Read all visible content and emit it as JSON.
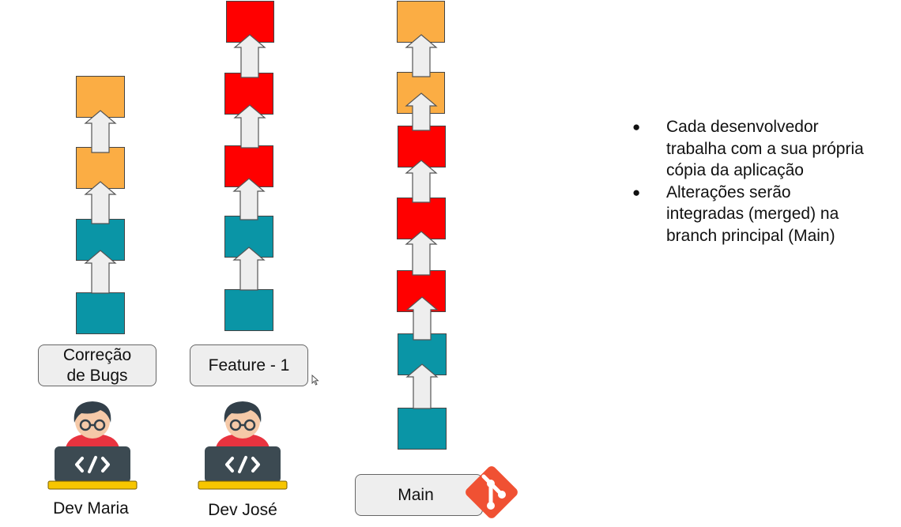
{
  "colors": {
    "orange": "#fbad44",
    "red": "#ff0000",
    "teal": "#0a95a6",
    "arrow_fill": "#eeeeee",
    "arrow_stroke": "#555555",
    "git_logo": "#f05133"
  },
  "branches": [
    {
      "id": "maria",
      "label": "Correção\nde Bugs",
      "dev_name": "Dev Maria",
      "commits": [
        "orange",
        "orange",
        "teal",
        "teal"
      ]
    },
    {
      "id": "jose",
      "label": "Feature - 1",
      "dev_name": "Dev José",
      "commits": [
        "red",
        "red",
        "red",
        "teal",
        "teal"
      ]
    },
    {
      "id": "main",
      "label": "Main",
      "commits": [
        "orange",
        "orange",
        "red",
        "red",
        "red",
        "teal",
        "teal"
      ]
    }
  ],
  "notes": [
    "Cada desenvolvedor trabalha com a sua própria cópia da aplicação",
    "Alterações serão integradas (merged) na branch principal (Main)"
  ],
  "icons": {
    "developer": "developer-laptop-icon",
    "git": "git-logo-icon",
    "code": "code-brackets-icon",
    "cursor": "mouse-cursor-icon"
  }
}
